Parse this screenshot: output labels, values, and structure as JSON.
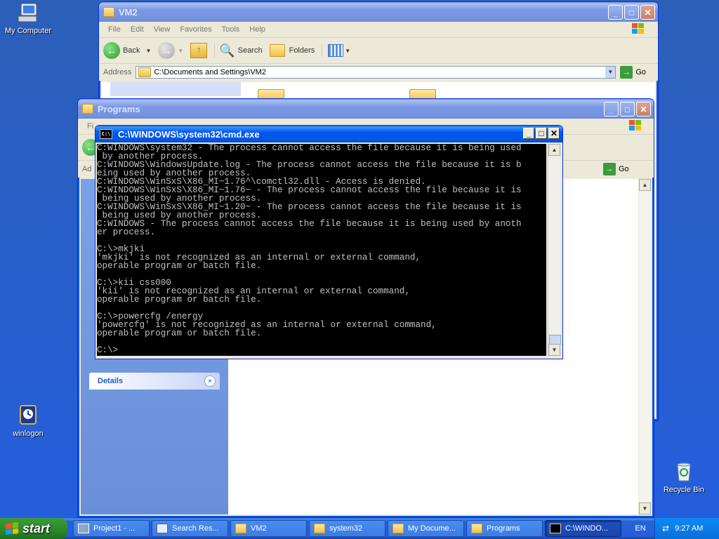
{
  "desktop": {
    "icons": [
      {
        "label": "My Computer"
      },
      {
        "label": "winlogon"
      },
      {
        "label": "Recycle Bin"
      }
    ]
  },
  "vm2": {
    "title": "VM2",
    "menu": [
      "File",
      "Edit",
      "View",
      "Favorites",
      "Tools",
      "Help"
    ],
    "back_label": "Back",
    "search_label": "Search",
    "folders_label": "Folders",
    "address_label": "Address",
    "address_value": "C:\\Documents and Settings\\VM2",
    "go_label": "Go"
  },
  "programs": {
    "title": "Programs",
    "menu_partial": "Fi",
    "address_partial": "Ad",
    "go_label": "Go",
    "details_label": "Details"
  },
  "cmd": {
    "title": "C:\\WINDOWS\\system32\\cmd.exe",
    "icon_text": "C:\\",
    "lines": [
      "C:WINDOWS\\system32 - The process cannot access the file because it is being used",
      " by another process.",
      "C:WINDOWS\\WindowsUpdate.log - The process cannot access the file because it is b",
      "eing used by another process.",
      "C:WINDOWS\\WinSxS\\X86_MI~1.76^\\comctl32.dll - Access is denied.",
      "C:WINDOWS\\WinSxS\\X86_MI~1.76~ - The process cannot access the file because it is",
      " being used by another process.",
      "C:WINDOWS\\WinSxS\\X86_MI~1.20~ - The process cannot access the file because it is",
      " being used by another process.",
      "C:WINDOWS - The process cannot access the file because it is being used by anoth",
      "er process.",
      "",
      "C:\\>mkjki",
      "'mkjki' is not recognized as an internal or external command,",
      "operable program or batch file.",
      "",
      "C:\\>kii css000",
      "'kii' is not recognized as an internal or external command,",
      "operable program or batch file.",
      "",
      "C:\\>powercfg /energy",
      "'powercfg' is not recognized as an internal or external command,",
      "operable program or batch file.",
      "",
      "C:\\>"
    ]
  },
  "taskbar": {
    "start_label": "start",
    "tasks": [
      {
        "label": "Project1 - ..."
      },
      {
        "label": "Search Res..."
      },
      {
        "label": "VM2"
      },
      {
        "label": "system32"
      },
      {
        "label": "My Docume..."
      },
      {
        "label": "Programs"
      },
      {
        "label": "C:\\WINDO..."
      }
    ],
    "lang": "EN",
    "clock": "9:27 AM"
  }
}
